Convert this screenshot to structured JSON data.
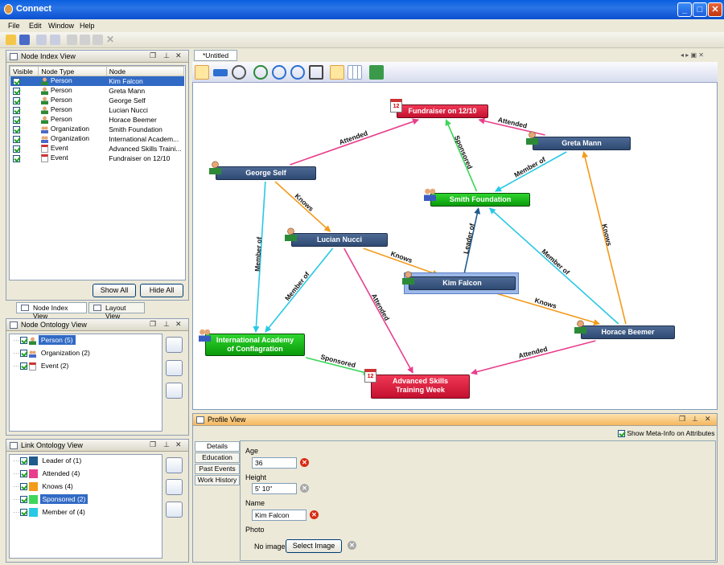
{
  "window": {
    "title": "Connect"
  },
  "menu": [
    "File",
    "Edit",
    "Window",
    "Help"
  ],
  "node_index": {
    "title": "Node Index View",
    "columns": [
      "Visible",
      "Node Type",
      "Node"
    ],
    "rows": [
      {
        "type": "Person",
        "node": "Kim Falcon",
        "selected": true,
        "icon": "person"
      },
      {
        "type": "Person",
        "node": "Greta Mann",
        "icon": "person"
      },
      {
        "type": "Person",
        "node": "George Self",
        "icon": "person"
      },
      {
        "type": "Person",
        "node": "Lucian Nucci",
        "icon": "person"
      },
      {
        "type": "Person",
        "node": "Horace Beemer",
        "icon": "person"
      },
      {
        "type": "Organization",
        "node": "Smith Foundation",
        "icon": "org"
      },
      {
        "type": "Organization",
        "node": "International Academ...",
        "icon": "org"
      },
      {
        "type": "Event",
        "node": "Advanced Skills Traini...",
        "icon": "event"
      },
      {
        "type": "Event",
        "node": "Fundraiser on 12/10",
        "icon": "event"
      }
    ],
    "show_all": "Show All",
    "hide_all": "Hide All"
  },
  "left_tabs": [
    "Node Index View",
    "Layout View"
  ],
  "node_ontology": {
    "title": "Node Ontology View",
    "items": [
      {
        "label": "Person (5)",
        "selected": true,
        "icon": "person"
      },
      {
        "label": "Organization (2)",
        "icon": "org"
      },
      {
        "label": "Event (2)",
        "icon": "event"
      }
    ]
  },
  "link_ontology": {
    "title": "Link Ontology View",
    "items": [
      {
        "label": "Leader of (1)",
        "color": "#1f5a8c"
      },
      {
        "label": "Attended (4)",
        "color": "#e83e8c"
      },
      {
        "label": "Knows (4)",
        "color": "#f39a1a"
      },
      {
        "label": "Sponsored (2)",
        "color": "#3ed65c",
        "selected": true
      },
      {
        "label": "Member of (4)",
        "color": "#27c8e6"
      }
    ]
  },
  "graph": {
    "tab_title": "*Untitled",
    "nodes": {
      "fund": {
        "label": "Fundraiser on 12/10",
        "kind": "event",
        "icon_text": "12"
      },
      "greta": {
        "label": "Greta Mann",
        "kind": "person"
      },
      "george": {
        "label": "George Self",
        "kind": "person"
      },
      "smith": {
        "label": "Smith Foundation",
        "kind": "org"
      },
      "lucian": {
        "label": "Lucian Nucci",
        "kind": "person"
      },
      "kim": {
        "label": "Kim Falcon",
        "kind": "person",
        "selected": true
      },
      "horace": {
        "label": "Horace Beemer",
        "kind": "person"
      },
      "intl": {
        "label": "International Academy of Conflagration",
        "label1": "International Academy",
        "label2": "of Conflagration",
        "kind": "org"
      },
      "adv": {
        "label": "Advanced Skills Training Week",
        "label1": "Advanced Skills",
        "label2": "Training Week",
        "kind": "event",
        "icon_text": "12"
      }
    },
    "edges": [
      {
        "from": "george",
        "to": "fund",
        "label": "Attended",
        "color": "#e83e8c"
      },
      {
        "from": "smith",
        "to": "fund",
        "label": "Sponsored",
        "color": "#3ed65c"
      },
      {
        "from": "greta",
        "to": "fund",
        "label": "Attended",
        "color": "#e83e8c"
      },
      {
        "from": "greta",
        "to": "smith",
        "label": "Member of",
        "color": "#27c8e6"
      },
      {
        "from": "george",
        "to": "lucian",
        "label": "Knows",
        "color": "#f39a1a"
      },
      {
        "from": "george",
        "to": "intl",
        "label": "Member of",
        "color": "#27c8e6"
      },
      {
        "from": "lucian",
        "to": "intl",
        "label": "Member of",
        "color": "#27c8e6"
      },
      {
        "from": "lucian",
        "to": "kim",
        "label": "Knows",
        "color": "#f39a1a"
      },
      {
        "from": "lucian",
        "to": "adv",
        "label": "Attended",
        "color": "#e83e8c"
      },
      {
        "from": "kim",
        "to": "smith",
        "label": "Leader of",
        "color": "#1f5a8c"
      },
      {
        "from": "kim",
        "to": "horace",
        "label": "Knows",
        "color": "#f39a1a"
      },
      {
        "from": "horace",
        "to": "smith",
        "label": "Member of",
        "color": "#27c8e6"
      },
      {
        "from": "horace",
        "to": "greta",
        "label": "Knows",
        "color": "#f39a1a"
      },
      {
        "from": "horace",
        "to": "adv",
        "label": "Attended",
        "color": "#e83e8c"
      },
      {
        "from": "intl",
        "to": "adv",
        "label": "Sponsored",
        "color": "#3ed65c"
      }
    ]
  },
  "profile": {
    "title": "Profile View",
    "meta_checkbox": "Show Meta-Info on Attributes",
    "tabs": [
      "Details",
      "Education",
      "Past Events",
      "Work History"
    ],
    "age_label": "Age",
    "age": "36",
    "height_label": "Height",
    "height": "5' 10\"",
    "name_label": "Name",
    "name": "Kim Falcon",
    "photo_label": "Photo",
    "no_image": "No image",
    "select_image": "Select Image"
  }
}
